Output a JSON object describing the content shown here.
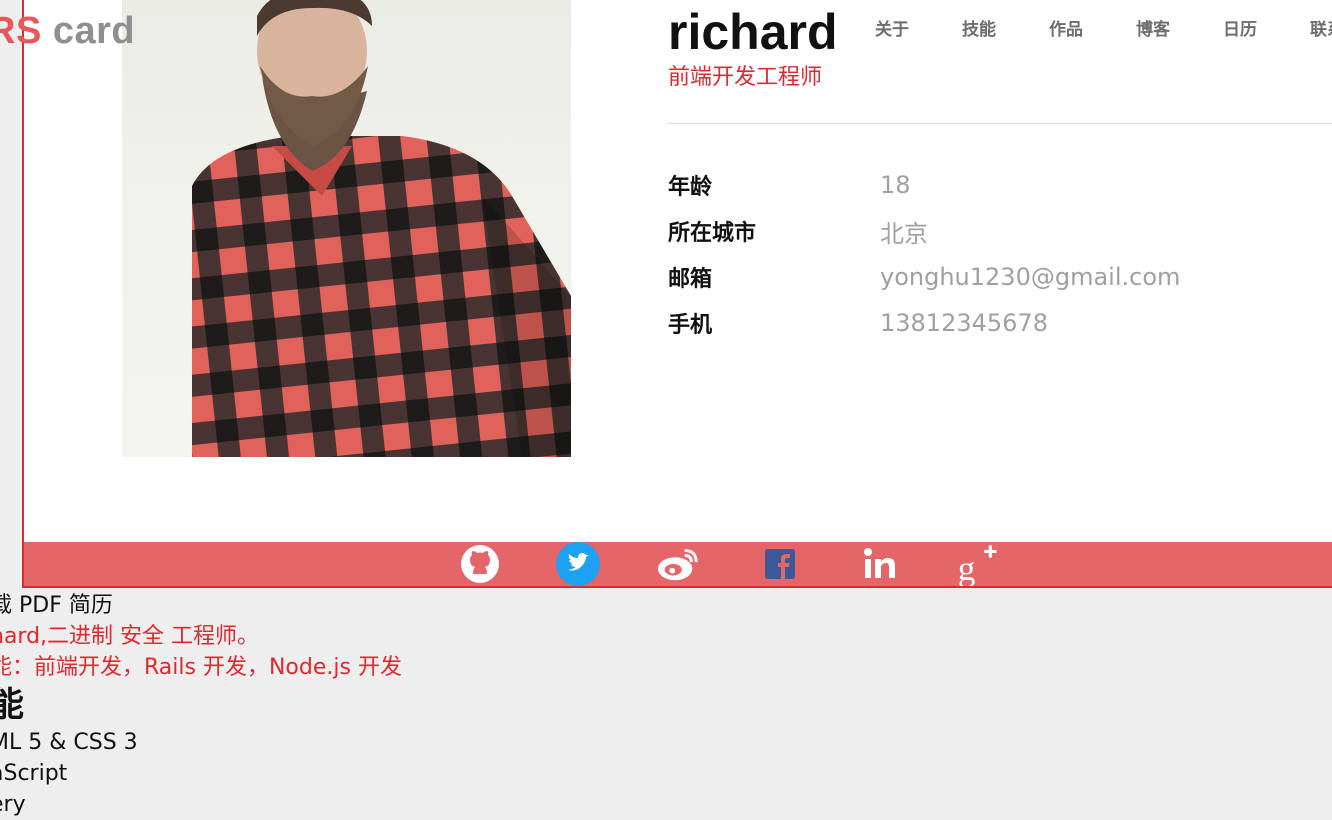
{
  "logo": {
    "part1": "RS",
    "part2": " card"
  },
  "profile": {
    "name": "richard",
    "title": "前端开发工程师"
  },
  "nav": [
    "关于",
    "技能",
    "作品",
    "博客",
    "日历",
    "联系方"
  ],
  "info": [
    {
      "label": "年龄",
      "value": "18"
    },
    {
      "label": "所在城市",
      "value": "北京"
    },
    {
      "label": "邮箱",
      "value": "yonghu1230@gmail.com"
    },
    {
      "label": "手机",
      "value": "13812345678"
    }
  ],
  "social_icons": [
    "github-icon",
    "twitter-icon",
    "weibo-icon",
    "facebook-icon",
    "linkedin-icon",
    "google-plus-icon"
  ],
  "colors": {
    "accent": "#e0282e",
    "social_bar": "#e46668",
    "twitter": "#1da1f2"
  },
  "below": {
    "download": "载 PDF 简历",
    "intro": "hard,二进制 安全 工程师。",
    "skills_line": "能：前端开发，Rails 开发，Node.js 开发",
    "skills_heading": "能",
    "skill_items": [
      "ML 5 & CSS 3",
      "aScript",
      "ery"
    ]
  }
}
